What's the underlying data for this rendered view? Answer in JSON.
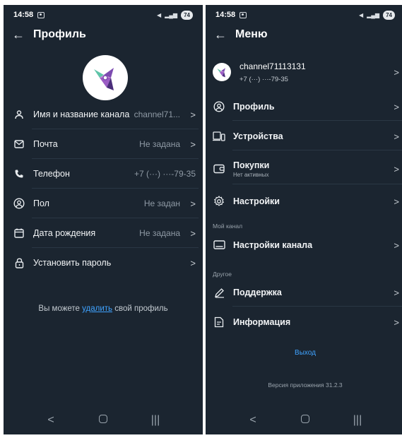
{
  "left": {
    "status_time": "14:58",
    "battery": "74",
    "title": "Профиль",
    "rows": [
      {
        "label": "Имя и название канала",
        "value": "channel71...",
        "chevron": ">"
      },
      {
        "label": "Почта",
        "value": "Не задана",
        "chevron": ">"
      },
      {
        "label": "Телефон",
        "value": "+7 (···) ···-79-35",
        "chevron": ""
      },
      {
        "label": "Пол",
        "value": "Не задан",
        "chevron": ">"
      },
      {
        "label": "Дата рождения",
        "value": "Не задана",
        "chevron": ">"
      },
      {
        "label": "Установить пароль",
        "value": "",
        "chevron": ">"
      }
    ],
    "note_before": "Вы можете ",
    "note_link": "удалить",
    "note_after": " свой профиль"
  },
  "right": {
    "status_time": "14:58",
    "battery": "74",
    "title": "Меню",
    "account": {
      "name": "channel71113131",
      "phone": "+7 (···) ···-79-35"
    },
    "items": [
      {
        "label": "Профиль",
        "sub": ""
      },
      {
        "label": "Устройства",
        "sub": ""
      },
      {
        "label": "Покупки",
        "sub": "Нет активных"
      },
      {
        "label": "Настройки",
        "sub": ""
      }
    ],
    "section_channel": "Мой канал",
    "channel_settings": "Настройки канала",
    "section_other": "Другое",
    "support": "Поддержка",
    "info": "Информация",
    "logout": "Выход",
    "version": "Версия приложения 31.2.3"
  },
  "navbar": {
    "back": "<",
    "home": "○",
    "recents": "|||"
  },
  "colors": {
    "background": "#1b2530",
    "accent": "#3fa3ff",
    "text": "#f2f4f6",
    "muted": "#8f9aa5"
  }
}
